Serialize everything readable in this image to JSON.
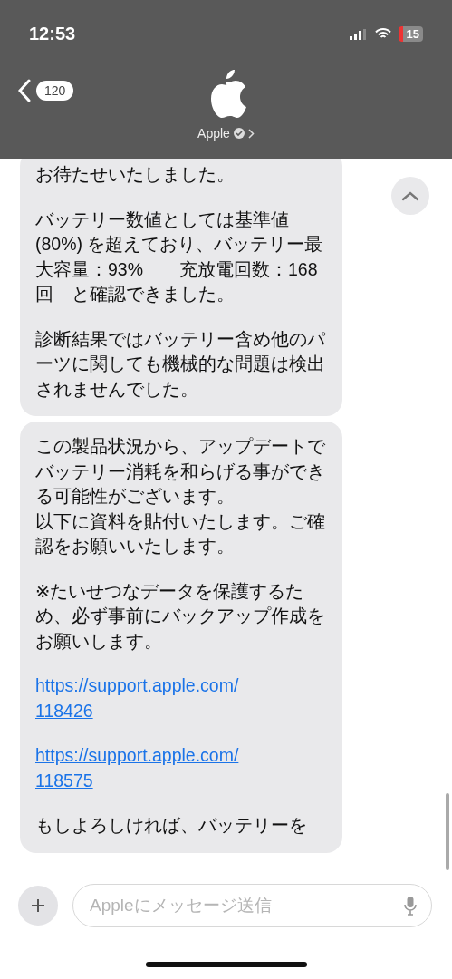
{
  "status_bar": {
    "time": "12:53",
    "battery": "15"
  },
  "header": {
    "back_count": "120",
    "contact_name": "Apple"
  },
  "messages": [
    {
      "paragraphs": [
        {
          "kind": "text",
          "text": "お待たせいたしました。"
        },
        {
          "kind": "text",
          "text": "バッテリー数値としては基準値(80%) を超えており、バッテリー最大容量：93%　　充放電回数：168回　と確認できました。"
        },
        {
          "kind": "text",
          "text": "診断結果ではバッテリー含め他のパーツに関しても機械的な問題は検出されませんでした。"
        }
      ]
    },
    {
      "paragraphs": [
        {
          "kind": "text",
          "text": "この製品状況から、アップデートでバッテリー消耗を和らげる事ができる可能性がございます。"
        },
        {
          "kind": "line",
          "text": "以下に資料を貼付いたします。ご確認をお願いいたします。"
        },
        {
          "kind": "text",
          "text": "※たいせつなデータを保護するため、必ず事前にバックアップ作成をお願いします。"
        },
        {
          "kind": "link",
          "text": "https://support.apple.com/\n118426"
        },
        {
          "kind": "link",
          "text": "https://support.apple.com/\n118575"
        },
        {
          "kind": "text",
          "text": "もしよろしければ、バッテリーを"
        }
      ]
    }
  ],
  "composer": {
    "placeholder": "Appleにメッセージ送信"
  }
}
